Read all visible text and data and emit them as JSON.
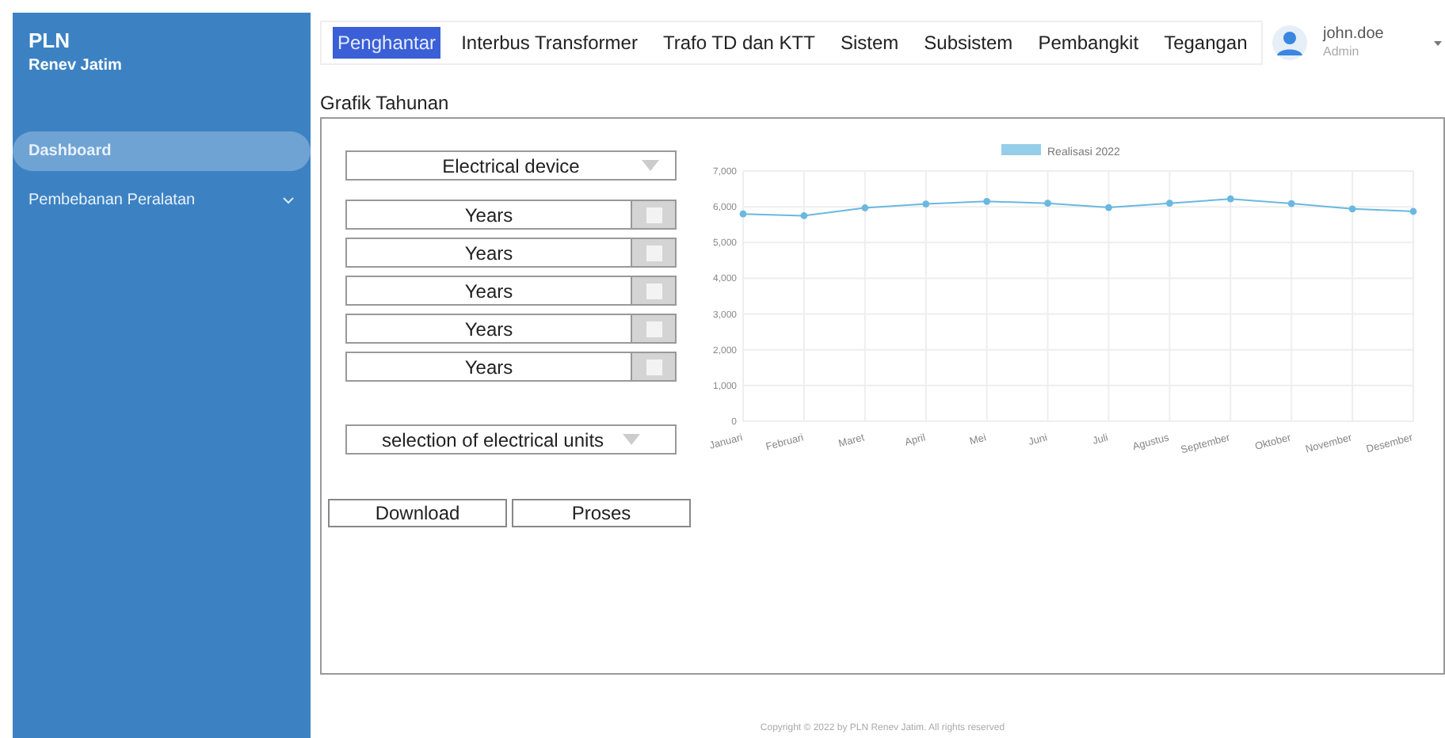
{
  "sidebar": {
    "brand": "PLN",
    "subtitle": "Renev Jatim",
    "items": [
      {
        "label": "Dashboard",
        "selected": true,
        "expandable": false
      },
      {
        "label": "Pembebanan Peralatan",
        "selected": false,
        "expandable": true
      }
    ]
  },
  "tabs": [
    {
      "label": "Penghantar",
      "selected": true
    },
    {
      "label": "Interbus Transformer",
      "selected": false
    },
    {
      "label": "Trafo TD dan KTT",
      "selected": false
    },
    {
      "label": "Sistem",
      "selected": false
    },
    {
      "label": "Subsistem",
      "selected": false
    },
    {
      "label": "Pembangkit",
      "selected": false
    },
    {
      "label": "Tegangan",
      "selected": false
    }
  ],
  "user": {
    "name": "john.doe",
    "role": "Admin"
  },
  "section_title": "Grafik Tahunan",
  "device_select": {
    "value": "Electrical device"
  },
  "year_fields": [
    {
      "label": "Years",
      "checked": false
    },
    {
      "label": "Years",
      "checked": false
    },
    {
      "label": "Years",
      "checked": false
    },
    {
      "label": "Years",
      "checked": false
    },
    {
      "label": "Years",
      "checked": false
    }
  ],
  "unit_select": {
    "value": "selection of electrical units"
  },
  "buttons": [
    "Download",
    "Proses"
  ],
  "chart": {
    "chart_data": {
      "type": "line",
      "categories": [
        "Januari",
        "Februari",
        "Maret",
        "April",
        "Mei",
        "Juni",
        "Juli",
        "Agustus",
        "September",
        "Oktober",
        "November",
        "Desember"
      ],
      "grid": true,
      "series": [
        {
          "name": "Realisasi 2022",
          "color": "#6ab8e0",
          "marker": "circle",
          "values": [
            5800,
            5750,
            5970,
            6080,
            6150,
            6100,
            5980,
            6100,
            6220,
            6090,
            5940,
            5870
          ]
        }
      ],
      "ylim": [
        0,
        7000
      ],
      "yticks": [
        {
          "value": 0,
          "label": "0"
        },
        {
          "value": 1000,
          "label": "1,000"
        },
        {
          "value": 2000,
          "label": "2,000"
        },
        {
          "value": 3000,
          "label": "3,000"
        },
        {
          "value": 4000,
          "label": "4,000"
        },
        {
          "value": 5000,
          "label": "5,000"
        },
        {
          "value": 6000,
          "label": "6,000"
        },
        {
          "value": 7000,
          "label": "7,000"
        }
      ]
    }
  },
  "footer": "Copyright © 2022 by PLN Renev Jatim. All rights reserved"
}
